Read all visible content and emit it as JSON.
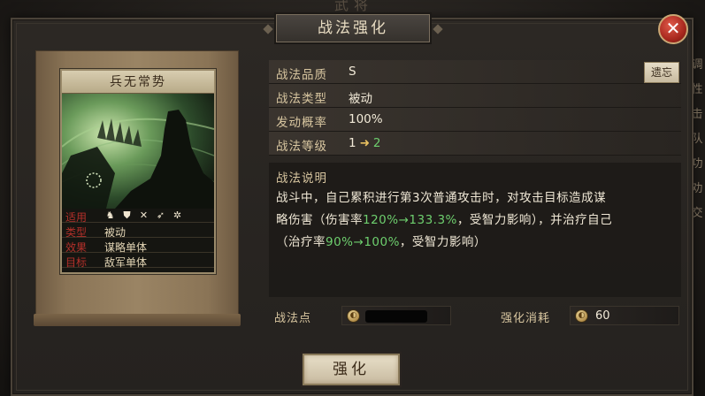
{
  "background": {
    "top_title": "武将",
    "right_edge_chars": [
      "调",
      "性",
      "击",
      "队",
      "功",
      "劝",
      "交"
    ]
  },
  "dialog": {
    "title": "战法强化",
    "close_label": "✕"
  },
  "card": {
    "name": "兵无常势",
    "rows": [
      {
        "key": "适用",
        "value": ""
      },
      {
        "key": "类型",
        "value": "被动"
      },
      {
        "key": "效果",
        "value": "谋略单体"
      },
      {
        "key": "目标",
        "value": "敌军单体"
      }
    ],
    "unit_icons": [
      "cavalry-icon",
      "shield-icon",
      "bow-icon",
      "spear-icon",
      "wheel-icon"
    ]
  },
  "details": {
    "quality_label": "战法品质",
    "quality_value": "S",
    "type_label": "战法类型",
    "type_value": "被动",
    "rate_label": "发动概率",
    "rate_value": "100%",
    "level_label": "战法等级",
    "level_from": "1",
    "level_to": "2",
    "forget_button": "遗忘"
  },
  "description": {
    "title": "战法说明",
    "line1_a": "战斗中，自己累积进行第3次普通攻击时，对攻击目标造成谋",
    "line2_a": "略伤害（伤害率",
    "line2_g": "120%→133.3%",
    "line2_b": "，受智力影响），并治疗自己",
    "line3_a": "（治疗率",
    "line3_g": "90%→100%",
    "line3_b": "，受智力影响）"
  },
  "footer": {
    "points_label": "战法点",
    "cost_label": "强化消耗",
    "cost_value": "60",
    "strengthen_button": "强化"
  },
  "colors": {
    "accent_red": "#b4302a",
    "highlight_green": "#6ecf6e",
    "gold": "#e8c060"
  }
}
